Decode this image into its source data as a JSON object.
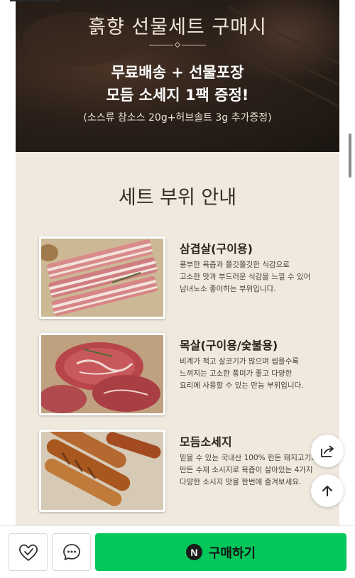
{
  "hero": {
    "title": "흙향 선물세트 구매시",
    "line1": "무료배송 + 선물포장",
    "line2": "모듬 소세지 1팩 증정!",
    "sub": "(소스류 참소스 20g+허브솔트 3g 추가증정)"
  },
  "section": {
    "title": "세트 부위 안내"
  },
  "items": [
    {
      "name": "삼겹살(구이용)",
      "desc": [
        "풍부한 육즙과 쫄깃쫄깃한 식감으로",
        "고소한 맛과 부드러운 식감을 느낄 수 있어",
        "남녀노소 좋아하는 부위입니다."
      ],
      "icon": "pork-belly-photo"
    },
    {
      "name": "목살(구이용/숯불용)",
      "desc": [
        "비계가 적고 살코기가 많으며 씹을수록",
        "느껴지는 고소한 풍미가 좋고 다양한",
        "요리에 사용할 수 있는 만능 부위입니다."
      ],
      "icon": "pork-neck-photo"
    },
    {
      "name": "모듬소세지",
      "desc": [
        "믿을 수 있는 국내산 100% 한돈 돼지고기로",
        "만든 수제 소시지로 육즙이 살아있는 4가지",
        "다양한 소시지 맛을 한번에 즐겨보세요."
      ],
      "icon": "sausage-photo"
    }
  ],
  "bottom_bar": {
    "buy_label": "구매하기",
    "buy_badge": "N",
    "like_icon": "heart-check-icon",
    "comment_icon": "speech-bubble-icon"
  },
  "floating": {
    "share_icon": "share-icon",
    "top_icon": "arrow-up-icon"
  },
  "colors": {
    "buy": "#03c75a",
    "hero_bg": "#2b2019",
    "content_bg": "#efe9de"
  }
}
